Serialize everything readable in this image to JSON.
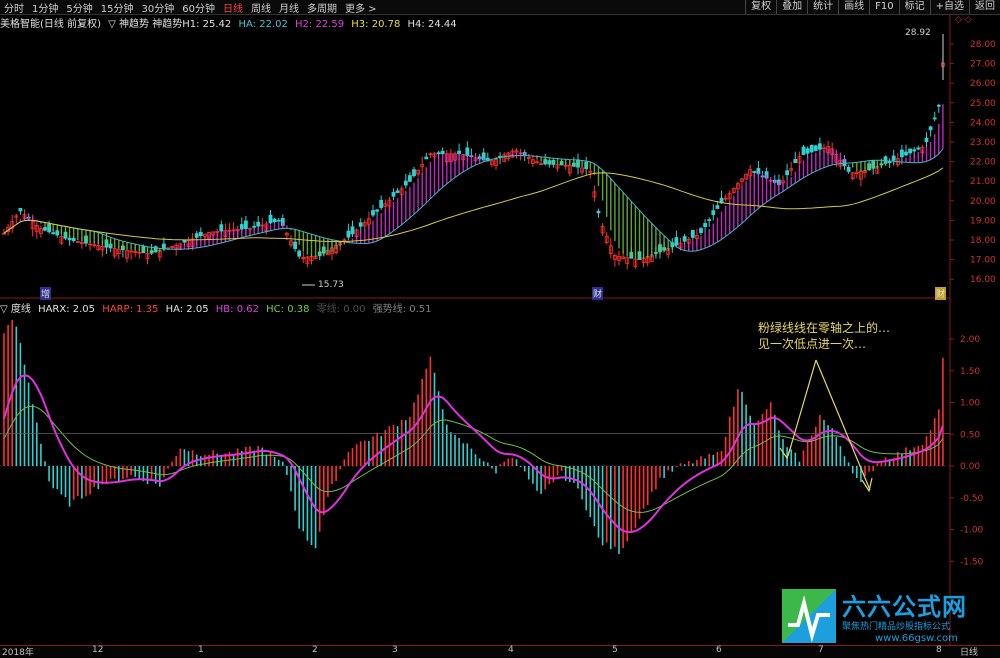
{
  "topbar": {
    "periods": [
      "分时",
      "1分钟",
      "5分钟",
      "15分钟",
      "30分钟",
      "60分钟",
      "日线",
      "周线",
      "月线",
      "多周期",
      "更多 >"
    ],
    "active_period": "日线",
    "tools": [
      "复权",
      "叠加",
      "统计",
      "画线",
      "F10",
      "标记",
      "+自选",
      "返回"
    ]
  },
  "main_info": {
    "name": "美格智能(日线 前复权)",
    "indicator": "▽ 神趋势 神趋势H1: 25.42",
    "ha": "HA: 22.02",
    "h2": "H2: 22.59",
    "h3": "H3: 20.78",
    "h4": "H4: 24.44"
  },
  "sub_info": {
    "name": "▽ 度线",
    "harx": "HARX: 2.05",
    "harp": "HARP: 1.35",
    "ha": "HA: 2.05",
    "hb": "HB: 0.62",
    "hc": "HC: 0.38",
    "zero": "零线: 0.00",
    "strong": "强势线: 0.51"
  },
  "price_axis": [
    "28.00",
    "27.00",
    "26.00",
    "25.00",
    "24.00",
    "23.00",
    "22.00",
    "21.00",
    "20.00",
    "19.00",
    "18.00",
    "17.00",
    "16.00"
  ],
  "osc_axis": [
    "2.00",
    "1.50",
    "1.00",
    "0.50",
    "0.00",
    "-0.50",
    "-1.00",
    "-1.50"
  ],
  "labels": {
    "high_price": "28.92",
    "low_price": "15.73",
    "corner": "◇ ◇",
    "bottom_right": "日线"
  },
  "markers": [
    "增",
    "财",
    "财"
  ],
  "date_axis": [
    "2018年",
    "12",
    "1",
    "2",
    "3",
    "4",
    "5",
    "6",
    "7",
    "8"
  ],
  "annotation": [
    "粉绿线线在零轴之上的…",
    "见一次低点进一次…"
  ],
  "logo": {
    "main": "六六公式网",
    "sub": "聚焦热门精品炒股指标公式",
    "url": "www.66gsw.com"
  },
  "colors": {
    "up": "#ff3030",
    "down": "#30d0d0",
    "magenta": "#e030e0",
    "green": "#70c040",
    "yellow": "#d8c840",
    "cyan_ma": "#40b8c8"
  }
}
